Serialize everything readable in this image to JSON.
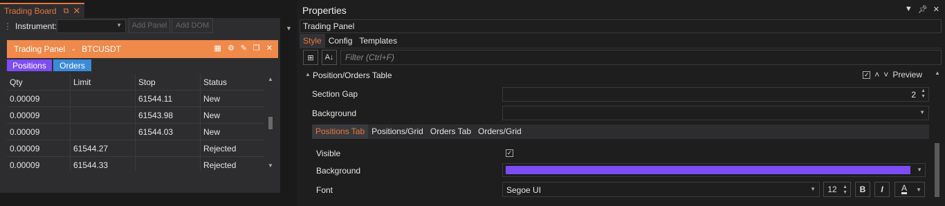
{
  "left_panel": {
    "doc_tab": {
      "title": "Trading Board"
    },
    "toolbar": {
      "instrument_label": "Instrument:",
      "instrument_value": "",
      "add_panel": "Add Panel",
      "add_dom": "Add DOM"
    },
    "trading_panel": {
      "title": "Trading Panel   -   BTCUSDT",
      "tabs": {
        "positions": "Positions",
        "orders": "Orders"
      },
      "columns": [
        "Qty",
        "Limit",
        "Stop",
        "Status"
      ],
      "rows": [
        [
          "0.00009",
          "",
          "61544.11",
          "New"
        ],
        [
          "0.00009",
          "",
          "61543.98",
          "New"
        ],
        [
          "0.00009",
          "",
          "61544.03",
          "New"
        ],
        [
          "0.00009",
          "61544.27",
          "",
          "Rejected"
        ],
        [
          "0.00009",
          "61544.33",
          "",
          "Rejected"
        ]
      ]
    }
  },
  "properties": {
    "title": "Properties",
    "object_name": "Trading Panel",
    "tabs": [
      "Style",
      "Config",
      "Templates"
    ],
    "filter_placeholder": "Filter (Ctrl+F)",
    "section": {
      "title": "Position/Orders Table",
      "preview_label": "Preview"
    },
    "section_gap": {
      "label": "Section Gap",
      "value": "2"
    },
    "background": {
      "label": "Background"
    },
    "sub_tabs": [
      "Positions Tab",
      "Positions/Grid",
      "Orders Tab",
      "Orders/Grid"
    ],
    "positions_tab": {
      "visible_label": "Visible",
      "background_label": "Background",
      "background_color": "#7c4df5",
      "font_label": "Font",
      "font_value": "Segoe UI",
      "font_size": "12",
      "bold": "B",
      "italic": "I",
      "color_letter": "A"
    }
  },
  "colors": {
    "accent": "#e8773a",
    "panel_header": "#f08a4b",
    "positions_tab": "#7c4df5",
    "orders_tab": "#3a8bd9"
  }
}
